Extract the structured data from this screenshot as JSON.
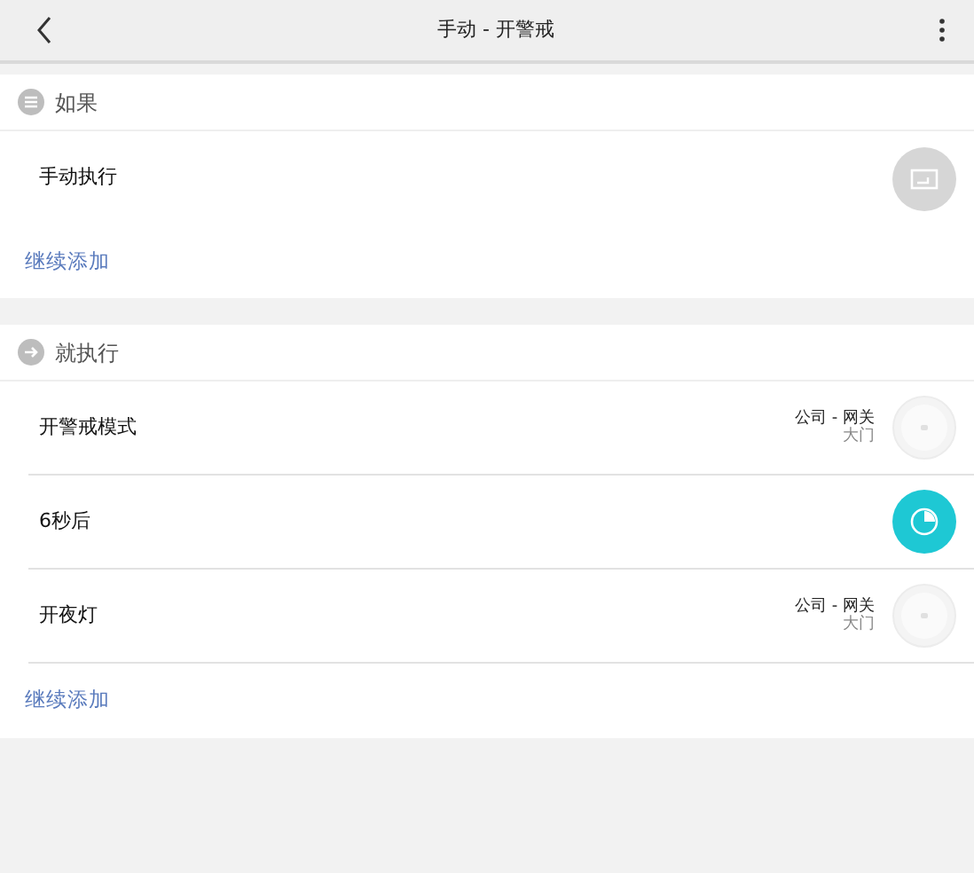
{
  "header": {
    "title": "手动 - 开警戒"
  },
  "sections": [
    {
      "kind": "condition",
      "label": "如果",
      "add_label": "继续添加",
      "rows": [
        {
          "kind": "manual",
          "name": "手动执行"
        }
      ]
    },
    {
      "kind": "action",
      "label": "就执行",
      "add_label": "继续添加",
      "rows": [
        {
          "kind": "device",
          "name": "开警戒模式",
          "place": "公司 - 网关",
          "room": "大门"
        },
        {
          "kind": "timer",
          "name": "6秒后"
        },
        {
          "kind": "device",
          "name": "开夜灯",
          "place": "公司 - 网关",
          "room": "大门"
        }
      ]
    }
  ]
}
